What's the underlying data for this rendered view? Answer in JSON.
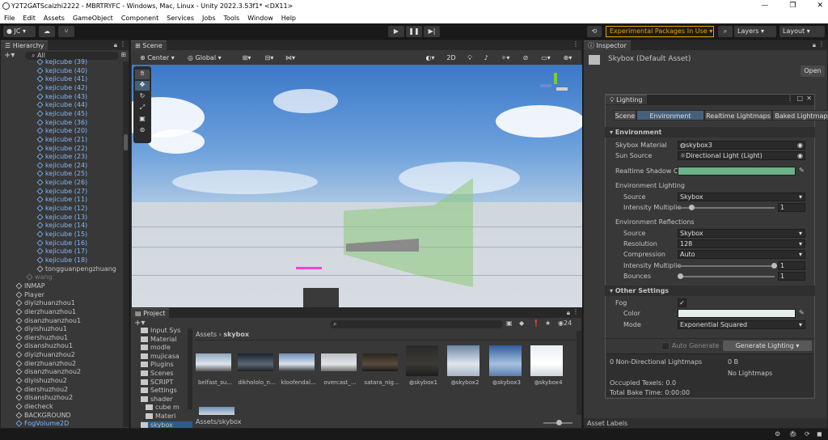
{
  "window": {
    "title": "Y2T2GATScaizhi2222 - MBRTRYFC - Windows, Mac, Linux - Unity 2022.3.53f1* <DX11>",
    "min_icon": "minimize-icon",
    "max_icon": "maximize-icon",
    "close_icon": "close-icon"
  },
  "menu": [
    "File",
    "Edit",
    "Assets",
    "GameObject",
    "Component",
    "Services",
    "Jobs",
    "Tools",
    "Window",
    "Help"
  ],
  "toolbar": {
    "account": "JC",
    "experimental": "Experimental Packages In Use",
    "layers": "Layers",
    "layout": "Layout"
  },
  "hierarchy": {
    "title": "Hierarchy",
    "search": "All",
    "items": [
      {
        "label": "kejicube (39)",
        "indent": 3,
        "color": "#7fb5ff",
        "icon": "cube-icon"
      },
      {
        "label": "kejicube (40)",
        "indent": 3,
        "color": "#7fb5ff",
        "icon": "cube-icon"
      },
      {
        "label": "kejicube (41)",
        "indent": 3,
        "color": "#7fb5ff",
        "icon": "cube-icon"
      },
      {
        "label": "kejicube (42)",
        "indent": 3,
        "color": "#7fb5ff",
        "icon": "cube-icon"
      },
      {
        "label": "kejicube (43)",
        "indent": 3,
        "color": "#7fb5ff",
        "icon": "cube-icon"
      },
      {
        "label": "kejicube (44)",
        "indent": 3,
        "color": "#7fb5ff",
        "icon": "cube-icon"
      },
      {
        "label": "kejicube (45)",
        "indent": 3,
        "color": "#7fb5ff",
        "icon": "cube-icon"
      },
      {
        "label": "kejicube (36)",
        "indent": 3,
        "color": "#7fb5ff",
        "icon": "cube-icon"
      },
      {
        "label": "kejicube (20)",
        "indent": 3,
        "color": "#7fb5ff",
        "icon": "cube-icon"
      },
      {
        "label": "kejicube (21)",
        "indent": 3,
        "color": "#7fb5ff",
        "icon": "cube-icon"
      },
      {
        "label": "kejicube (22)",
        "indent": 3,
        "color": "#7fb5ff",
        "icon": "cube-icon"
      },
      {
        "label": "kejicube (23)",
        "indent": 3,
        "color": "#7fb5ff",
        "icon": "cube-icon"
      },
      {
        "label": "kejicube (24)",
        "indent": 3,
        "color": "#7fb5ff",
        "icon": "cube-icon"
      },
      {
        "label": "kejicube (25)",
        "indent": 3,
        "color": "#7fb5ff",
        "icon": "cube-icon"
      },
      {
        "label": "kejicube (26)",
        "indent": 3,
        "color": "#7fb5ff",
        "icon": "cube-icon"
      },
      {
        "label": "kejicube (27)",
        "indent": 3,
        "color": "#7fb5ff",
        "icon": "cube-icon"
      },
      {
        "label": "kejicube (11)",
        "indent": 3,
        "color": "#7fb5ff",
        "icon": "cube-icon"
      },
      {
        "label": "kejicube (12)",
        "indent": 3,
        "color": "#7fb5ff",
        "icon": "cube-icon"
      },
      {
        "label": "kejicube (13)",
        "indent": 3,
        "color": "#7fb5ff",
        "icon": "cube-icon"
      },
      {
        "label": "kejicube (14)",
        "indent": 3,
        "color": "#7fb5ff",
        "icon": "cube-icon"
      },
      {
        "label": "kejicube (15)",
        "indent": 3,
        "color": "#7fb5ff",
        "icon": "cube-icon"
      },
      {
        "label": "kejicube (16)",
        "indent": 3,
        "color": "#7fb5ff",
        "icon": "cube-icon"
      },
      {
        "label": "kejicube (17)",
        "indent": 3,
        "color": "#7fb5ff",
        "icon": "cube-icon"
      },
      {
        "label": "kejicube (18)",
        "indent": 3,
        "color": "#7fb5ff",
        "icon": "cube-icon"
      },
      {
        "label": "tongguanpengzhuang",
        "indent": 3,
        "color": "#c4c4c4",
        "icon": "cube-icon"
      },
      {
        "label": "wang",
        "indent": 2,
        "color": "#7a7a7a",
        "icon": "cube-icon"
      },
      {
        "label": "INMAP",
        "indent": 1,
        "color": "#c4c4c4",
        "icon": "cube-icon"
      },
      {
        "label": "Player",
        "indent": 1,
        "color": "#c4c4c4",
        "icon": "cube-icon"
      },
      {
        "label": "diyizhuanzhou1",
        "indent": 1,
        "color": "#c4c4c4",
        "icon": "cube-icon"
      },
      {
        "label": "dierzhuanzhou1",
        "indent": 1,
        "color": "#c4c4c4",
        "icon": "cube-icon"
      },
      {
        "label": "disanzhuanzhou1",
        "indent": 1,
        "color": "#c4c4c4",
        "icon": "cube-icon"
      },
      {
        "label": "diyishuzhou1",
        "indent": 1,
        "color": "#c4c4c4",
        "icon": "cube-icon"
      },
      {
        "label": "diershuzhou1",
        "indent": 1,
        "color": "#c4c4c4",
        "icon": "cube-icon"
      },
      {
        "label": "disanshuzhou1",
        "indent": 1,
        "color": "#c4c4c4",
        "icon": "cube-icon"
      },
      {
        "label": "diyizhuanzhou2",
        "indent": 1,
        "color": "#c4c4c4",
        "icon": "cube-icon"
      },
      {
        "label": "dierzhuanzhou2",
        "indent": 1,
        "color": "#c4c4c4",
        "icon": "cube-icon"
      },
      {
        "label": "disanzhuanzhou2",
        "indent": 1,
        "color": "#c4c4c4",
        "icon": "cube-icon"
      },
      {
        "label": "diyishuzhou2",
        "indent": 1,
        "color": "#c4c4c4",
        "icon": "cube-icon"
      },
      {
        "label": "diershuzhou2",
        "indent": 1,
        "color": "#c4c4c4",
        "icon": "cube-icon"
      },
      {
        "label": "disanshuzhou2",
        "indent": 1,
        "color": "#c4c4c4",
        "icon": "cube-icon"
      },
      {
        "label": "diecheck",
        "indent": 1,
        "color": "#c4c4c4",
        "icon": "cube-icon"
      },
      {
        "label": "BACKGROUND",
        "indent": 1,
        "color": "#c4c4c4",
        "icon": "cube-icon"
      },
      {
        "label": "FogVolume2D",
        "indent": 1,
        "color": "#7fb5ff",
        "icon": "cube-icon"
      }
    ]
  },
  "scene": {
    "tab": "Scene",
    "pivot": "Center",
    "space": "Global",
    "mode2d": "2D"
  },
  "project": {
    "tab": "Project",
    "count": "24",
    "breadcrumb_root": "Assets",
    "breadcrumb_leaf": "skybox",
    "path": "Assets/skybox",
    "folders": [
      {
        "label": "Input Sys",
        "indent": 2
      },
      {
        "label": "Material",
        "indent": 2
      },
      {
        "label": "modle",
        "indent": 2
      },
      {
        "label": "mujicasa",
        "indent": 2
      },
      {
        "label": "Plugins",
        "indent": 2
      },
      {
        "label": "Scenes",
        "indent": 2
      },
      {
        "label": "SCRIPT",
        "indent": 2
      },
      {
        "label": "Settings",
        "indent": 2
      },
      {
        "label": "shader",
        "indent": 2
      },
      {
        "label": "cube m",
        "indent": 3
      },
      {
        "label": "Materi",
        "indent": 3
      },
      {
        "label": "skybox",
        "indent": 2
      }
    ],
    "assets": [
      {
        "label": "belfast_su...",
        "colors": [
          "#8ea6bf",
          "#dfe6ee",
          "#555"
        ]
      },
      {
        "label": "dikhololo_n...",
        "colors": [
          "#1b2330",
          "#5a6775",
          "#202020"
        ]
      },
      {
        "label": "kloofendal...",
        "colors": [
          "#6e8fb8",
          "#d9e2ec",
          "#3c3c3c"
        ]
      },
      {
        "label": "overcast_...",
        "colors": [
          "#b9bec4",
          "#e3e5e8",
          "#6a6a6a"
        ]
      },
      {
        "label": "satara_nig...",
        "colors": [
          "#2a2520",
          "#5a4b3d",
          "#1a1a1a"
        ]
      },
      {
        "label": "skybox1",
        "colors": [
          "#2a2a2a",
          "#3c3a36",
          "#1e1e1e"
        ]
      },
      {
        "label": "skybox2",
        "colors": [
          "#6c86a8",
          "#dfe5ed",
          "#a7b5c5"
        ]
      },
      {
        "label": "skybox3",
        "colors": [
          "#2f5c9c",
          "#a8c1de",
          "#5b7fb0"
        ]
      },
      {
        "label": "skybox4",
        "colors": [
          "#e8eef4",
          "#ffffff",
          "#d0d6dc"
        ]
      }
    ]
  },
  "inspector": {
    "tab": "Inspector",
    "object": "Skybox (Default Asset)",
    "open_button": "Open",
    "asset_labels": "Asset Labels"
  },
  "lighting": {
    "title": "Lighting",
    "tabs": [
      "Scene",
      "Environment",
      "Realtime Lightmaps",
      "Baked Lightmaps"
    ],
    "active_tab": 1,
    "env_header": "Environment",
    "skybox_material_label": "Skybox Material",
    "skybox_material_value": "skybox3",
    "sun_source_label": "Sun Source",
    "sun_source_value": "Directional Light (Light)",
    "shadow_label": "Realtime Shadow C",
    "shadow_color": "#6fb18a",
    "env_lighting_header": "Environment Lighting",
    "source_label": "Source",
    "source_value": "Skybox",
    "intensity_label": "Intensity Multiplie",
    "intensity_value": "1",
    "env_reflections_header": "Environment Reflections",
    "refl_source_label": "Source",
    "refl_source_value": "Skybox",
    "resolution_label": "Resolution",
    "resolution_value": "128",
    "compression_label": "Compression",
    "compression_value": "Auto",
    "refl_intensity_label": "Intensity Multiplie",
    "refl_intensity_value": "1",
    "bounces_label": "Bounces",
    "bounces_value": "1",
    "other_header": "Other Settings",
    "fog_label": "Fog",
    "color_label": "Color",
    "fog_color": "#e7eeee",
    "mode_label": "Mode",
    "mode_value": "Exponential Squared",
    "auto_generate": "Auto Generate",
    "generate_button": "Generate Lighting",
    "stat_nd": "0 Non-Directional Lightmaps",
    "stat_size": "0 B",
    "stat_nolm": "No Lightmaps",
    "stat_texels": "Occupied Texels: 0.0",
    "stat_bake": "Total Bake Time: 0:00:00"
  }
}
